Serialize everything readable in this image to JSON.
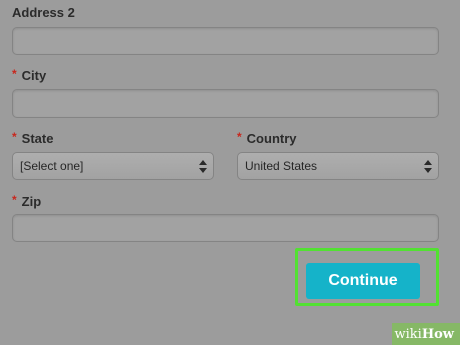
{
  "form": {
    "address2": {
      "label": "Address 2",
      "value": ""
    },
    "city": {
      "required_mark": "*",
      "label": "City",
      "value": ""
    },
    "state": {
      "required_mark": "*",
      "label": "State",
      "selected": "[Select one]"
    },
    "country": {
      "required_mark": "*",
      "label": "Country",
      "selected": "United States"
    },
    "zip": {
      "required_mark": "*",
      "label": "Zip",
      "value": ""
    }
  },
  "actions": {
    "continue_label": "Continue",
    "highlight_color": "#52e132",
    "button_color": "#15b3c9"
  },
  "watermark": {
    "prefix": "wiki",
    "suffix": "How"
  },
  "colors": {
    "required": "#c8271d",
    "background": "#9c9c9c"
  }
}
